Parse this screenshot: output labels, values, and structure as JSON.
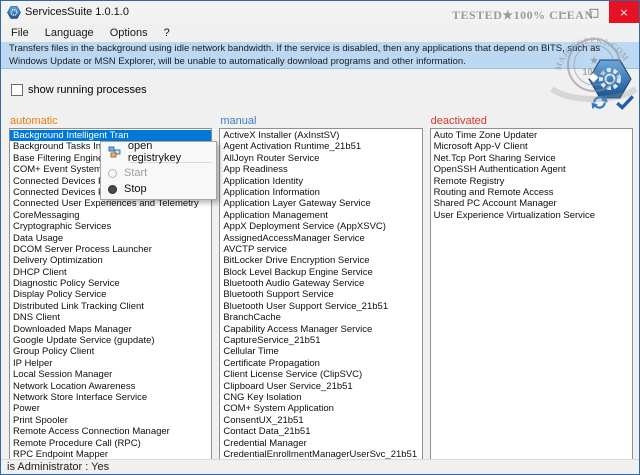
{
  "window": {
    "title": "ServicesSuite 1.0.1.0",
    "buttons": {
      "minimize": "–",
      "maximize": "□",
      "close": "×"
    }
  },
  "menu": {
    "items": [
      "File",
      "Language",
      "Options",
      "?"
    ]
  },
  "banner": {
    "text": "Transfers files in the background using idle network bandwidth. If the service is disabled, then any applications that depend on BITS, such as Windows Update or MSN Explorer, will be unable to automatically download programs and other information.",
    "background": "#bdd8f3"
  },
  "toolbar": {
    "checkbox_label": "show running processes",
    "checkbox_checked": false
  },
  "columns": [
    {
      "id": "automatic",
      "header": "automatic",
      "header_color": "#e87d0e",
      "selected_index": 0,
      "items": [
        "Background Intelligent Tran",
        "Background Tasks Infrastructure Service",
        "Base Filtering Engine",
        "COM+ Event System",
        "Connected Devices Platform Service",
        "Connected Devices Platform User Service_21b51",
        "Connected User Experiences and Telemetry",
        "CoreMessaging",
        "Cryptographic Services",
        "Data Usage",
        "DCOM Server Process Launcher",
        "Delivery Optimization",
        "DHCP Client",
        "Diagnostic Policy Service",
        "Display Policy Service",
        "Distributed Link Tracking Client",
        "DNS Client",
        "Downloaded Maps Manager",
        "Google Update Service (gupdate)",
        "Group Policy Client",
        "IP Helper",
        "Local Session Manager",
        "Network Location Awareness",
        "Network Store Interface Service",
        "Power",
        "Print Spooler",
        "Remote Access Connection Manager",
        "Remote Procedure Call (RPC)",
        "RPC Endpoint Mapper"
      ]
    },
    {
      "id": "manual",
      "header": "manual",
      "header_color": "#3f7cc1",
      "items": [
        "ActiveX Installer (AxInstSV)",
        "Agent Activation Runtime_21b51",
        "AllJoyn Router Service",
        "App Readiness",
        "Application Identity",
        "Application Information",
        "Application Layer Gateway Service",
        "Application Management",
        "AppX Deployment Service (AppXSVC)",
        "AssignedAccessManager Service",
        "AVCTP service",
        "BitLocker Drive Encryption Service",
        "Block Level Backup Engine Service",
        "Bluetooth Audio Gateway Service",
        "Bluetooth Support Service",
        "Bluetooth User Support Service_21b51",
        "BranchCache",
        "Capability Access Manager Service",
        "CaptureService_21b51",
        "Cellular Time",
        "Certificate Propagation",
        "Client License Service (ClipSVC)",
        "Clipboard User Service_21b51",
        "CNG Key Isolation",
        "COM+ System Application",
        "ConsentUX_21b51",
        "Contact Data_21b51",
        "Credential Manager",
        "CredentialEnrollmentManagerUserSvc_21b51"
      ]
    },
    {
      "id": "deactivated",
      "header": "deactivated",
      "header_color": "#d03a30",
      "items": [
        "Auto Time Zone Updater",
        "Microsoft App-V Client",
        "Net.Tcp Port Sharing Service",
        "OpenSSH Authentication Agent",
        "Remote Registry",
        "Routing and Remote Access",
        "Shared PC Account Manager",
        "User Experience Virtualization Service"
      ]
    }
  ],
  "context_menu": {
    "items": [
      {
        "label": "open registrykey",
        "enabled": true,
        "icon": "registry-icon"
      },
      {
        "label": "Start",
        "enabled": false,
        "icon": "start-icon"
      },
      {
        "label": "Stop",
        "enabled": true,
        "icon": "stop-icon"
      }
    ]
  },
  "statusbar": {
    "text": "is Administrator : Yes"
  },
  "watermark": {
    "stamp_text": "TESTED★100% CLEAN",
    "site_text": "MAJORGEEKS.COM",
    "badge_text": "100%",
    "star": "★"
  },
  "colors": {
    "selection": "#0078d7",
    "close_button": "#e81123",
    "banner": "#bdd8f3"
  }
}
